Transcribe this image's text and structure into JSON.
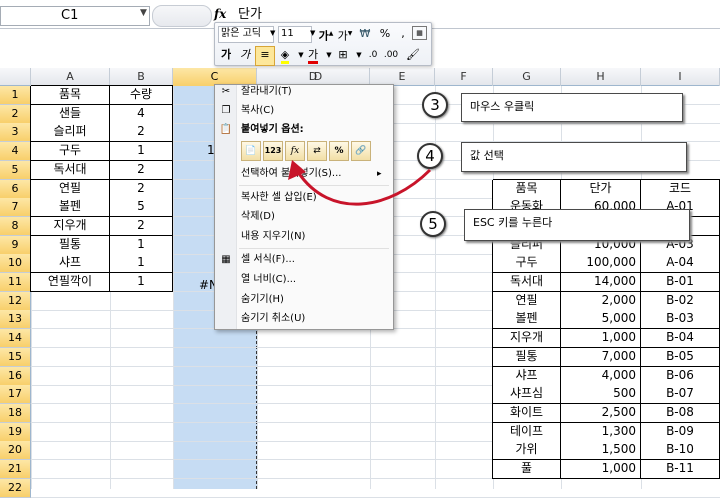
{
  "formula_bar": {
    "name_box": "C1",
    "fx": "fx",
    "value": "단가"
  },
  "mini_toolbar": {
    "font": "맑은 고딕",
    "size": "11",
    "bold": "가",
    "italic": "가",
    "font_color_letter": "가"
  },
  "columns": [
    "A",
    "B",
    "C",
    "D",
    "E",
    "F",
    "G",
    "H",
    "I"
  ],
  "rows": [
    "1",
    "2",
    "3",
    "4",
    "5",
    "6",
    "7",
    "8",
    "9",
    "10",
    "11",
    "12",
    "13",
    "14",
    "15",
    "16",
    "17",
    "18",
    "19",
    "20",
    "21",
    "22"
  ],
  "sheet_left": {
    "headers": [
      "품목",
      "수량"
    ],
    "data": [
      [
        "샌들",
        "4"
      ],
      [
        "슬리퍼",
        "2"
      ],
      [
        "구두",
        "1"
      ],
      [
        "독서대",
        "2"
      ],
      [
        "연필",
        "2"
      ],
      [
        "볼펜",
        "5"
      ],
      [
        "지우개",
        "2"
      ],
      [
        "필통",
        "1"
      ],
      [
        "샤프",
        "1"
      ],
      [
        "연필깍이",
        "1"
      ]
    ]
  },
  "column_c": {
    "header_fragment": "단",
    "row4_fragment": "1",
    "row11_fragment": "#N"
  },
  "column_d": {
    "header_fragment": "D"
  },
  "context_menu": {
    "items": [
      {
        "label": "잘라내기(T)",
        "icon": "scissors-icon"
      },
      {
        "label": "복사(C)",
        "icon": "copy-icon"
      },
      {
        "label": "붙여넣기 옵션:",
        "icon": "paste-icon"
      },
      {
        "label": "선택하여 붙여넣기(S)...",
        "icon": ""
      },
      {
        "label": "복사한 셀 삽입(E)",
        "icon": ""
      },
      {
        "label": "삭제(D)",
        "icon": ""
      },
      {
        "label": "내용 지우기(N)",
        "icon": ""
      },
      {
        "label": "셀 서식(F)...",
        "icon": "format-cells-icon"
      },
      {
        "label": "열 너비(C)...",
        "icon": ""
      },
      {
        "label": "숨기기(H)",
        "icon": ""
      },
      {
        "label": "숨기기 취소(U)",
        "icon": ""
      }
    ],
    "paste_buttons": [
      "paste-default",
      "paste-values-123",
      "paste-formulas-fx",
      "paste-transpose",
      "paste-percent",
      "paste-link"
    ],
    "paste_values_label": "123",
    "paste_formula_label": "fx",
    "paste_percent_label": "%"
  },
  "right_table": {
    "headers": [
      "품목",
      "단가",
      "코드"
    ],
    "rows": [
      [
        "운동화",
        "60,000",
        "A-01"
      ],
      [
        "",
        "",
        ""
      ],
      [
        "슬리퍼",
        "10,000",
        "A-03"
      ],
      [
        "구두",
        "100,000",
        "A-04"
      ],
      [
        "독서대",
        "14,000",
        "B-01"
      ],
      [
        "연필",
        "2,000",
        "B-02"
      ],
      [
        "볼펜",
        "5,000",
        "B-03"
      ],
      [
        "지우개",
        "1,000",
        "B-04"
      ],
      [
        "필통",
        "7,000",
        "B-05"
      ],
      [
        "샤프",
        "4,000",
        "B-06"
      ],
      [
        "샤프심",
        "500",
        "B-07"
      ],
      [
        "화이트",
        "2,500",
        "B-08"
      ],
      [
        "테이프",
        "1,300",
        "B-09"
      ],
      [
        "가위",
        "1,500",
        "B-10"
      ],
      [
        "풀",
        "1,000",
        "B-11"
      ]
    ]
  },
  "callouts": [
    {
      "num": "3",
      "text": "마우스 우클릭"
    },
    {
      "num": "4",
      "text": "값 선택"
    },
    {
      "num": "5",
      "text": "ESC 키를 누른다"
    }
  ]
}
